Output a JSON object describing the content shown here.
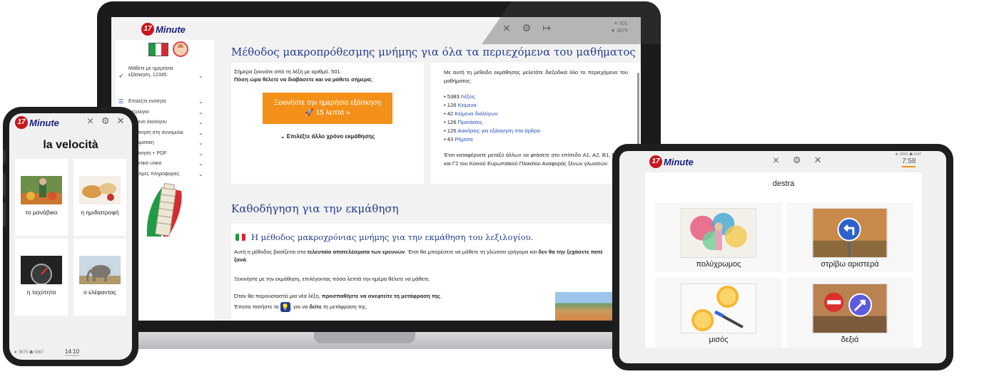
{
  "brand": {
    "logo_number": "17",
    "logo_text": "Minute"
  },
  "laptop": {
    "stats_top": "☀ 501",
    "stats_bottom": "★ 3675",
    "sidebar": {
      "daily_label": "Μάθετε με ημερήσια εξάσκηση, 12345:",
      "items": [
        "Επιλέξτε ενότητα",
        "Λεξιλόγιο",
        "Κείμενο διαλόγου",
        "Εξάσκηση στη συνομιλία",
        "Γραμματική",
        "Εξάσκηση + PDF",
        "Πρακτικό υλικό",
        "Χρήσιμες πληροφορίες"
      ]
    },
    "main": {
      "heading": "Μέθοδος μακροπρόθεσμης μνήμης για όλα τα περιεχόμενα του μαθήματος",
      "start_line": "Σήμερα ξεκινάτε από τη λέξη με αριθμό. 501.",
      "question": "Πόση ώρα θέλετε να διαβάσετε και να μάθετε σήμερα;",
      "start_button_line1": "Ξεκινήστε την ημερήσια εξάσκηση",
      "start_button_line2": "🚀 15 λεπτά »",
      "other_time": "⌄ Επιλέξτε άλλο χρόνο εκμάθησης",
      "right_intro": "Με αυτή τη μέθοδο εκμάθησης μελετάτε διεξοδικά όλο το περιεχόμενο του μαθήματος:",
      "stats": [
        {
          "num": "5383",
          "label": "Λέξεις"
        },
        {
          "num": "126",
          "label": "Κείμενα"
        },
        {
          "num": "42",
          "label": "Κείμενα διαλόγων"
        },
        {
          "num": "126",
          "label": "Προτάσεις"
        },
        {
          "num": "126",
          "label": "Ασκήσεις για εξάσκηση στα άρθρα"
        },
        {
          "num": "43",
          "label": "Ρήματα"
        }
      ],
      "right_outro": "Έτσι καταφέρνετε μεταξύ άλλων να φτάσετε στο επίπεδο A1, A2, B1, B2, Γ1 και Γ2 του Κοινού Ευρωπαϊκού Πλαισίου Αναφοράς ξένων γλωσσών.",
      "guide_heading": "Καθοδήγηση για την εκμάθηση",
      "guide_subheading": "Η μέθοδος μακροχρόνιας μνήμης για την εκμάθηση του λεξιλογίου.",
      "guide_p1_a": "Αυτή η μέθοδος βασίζεται στα ",
      "guide_p1_b": "τελευταία αποτελέσματα των ερευνών",
      "guide_p1_c": ". Έτσι θα μπορέσετε να μάθετε τη γλώσσα γρήγορα και ",
      "guide_p1_d": "δεν θα την ξεχάσετε ποτέ ξανά",
      "guide_p1_e": ".",
      "guide_p2": "Ξεκινήστε με την εκμάθηση, επιλέγοντας πόσα λεπτά την ημέρα θέλετε να μάθετε.",
      "guide_p3_a": "Όταν θα παρουσιαστεί μια νέα λέξη, ",
      "guide_p3_b": "προσπαθήστε να σκεφτείτε τη μετάφραση της",
      "guide_p3_c": ".",
      "guide_p4_a": "Έπειτα πατήστε το ",
      "guide_p4_b": ", για να ",
      "guide_p4_c": "δείτε",
      "guide_p4_d": " τη μετάφραση της."
    }
  },
  "phone": {
    "title": "la velocità",
    "tiles": [
      {
        "label": "το μανάβικο"
      },
      {
        "label": "η ημιδιατροφή"
      },
      {
        "label": "η ταχύτητα"
      },
      {
        "label": "ο ελέφαντας"
      }
    ],
    "stats": "★ 3675 ☗ 5867",
    "time": "14:10"
  },
  "tablet": {
    "stats": "★ 2843 ☗ 5/47",
    "time": "7:58",
    "word": "destra",
    "tiles": [
      {
        "label": "πολύχρωμος"
      },
      {
        "label": "στρίβω αριστερά"
      },
      {
        "label": "μισός"
      },
      {
        "label": "δεξιά"
      }
    ]
  },
  "colors": {
    "accent": "#f39019",
    "heading": "#243b8e",
    "link": "#2a4dbd",
    "logo_red": "#c8161d"
  }
}
